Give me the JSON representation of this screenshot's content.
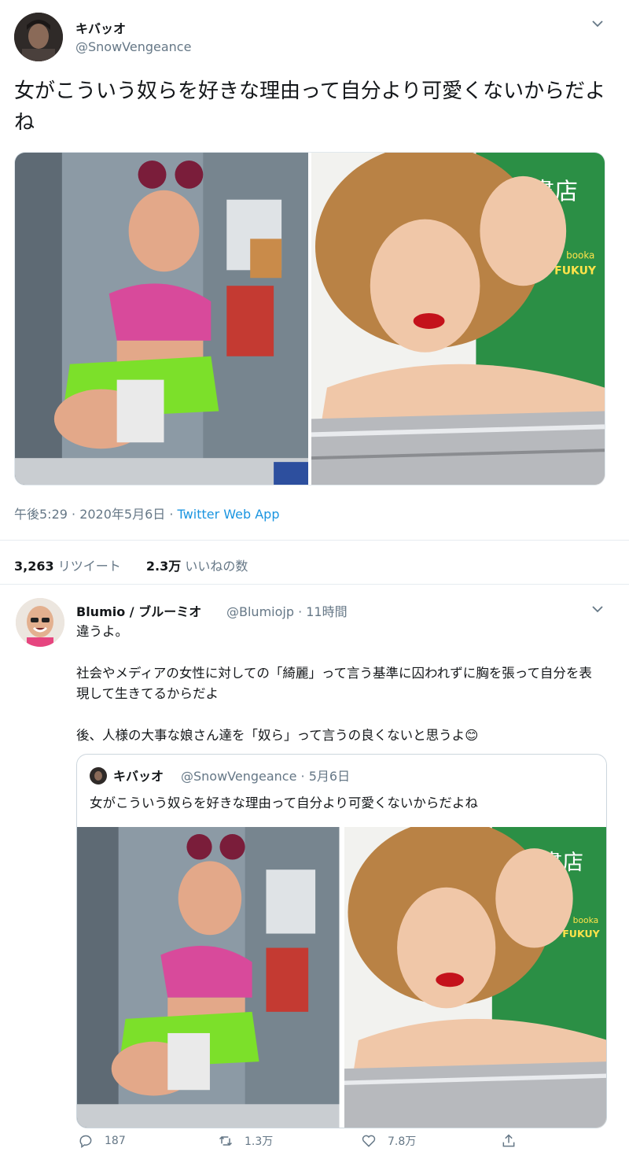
{
  "tweet": {
    "author_name": "キバッオ",
    "author_handle": "@SnowVengeance",
    "text": "女がこういう奴らを好きな理由って自分より可愛くないからだよね",
    "timestamp": "午後5:29 · 2020年5月6日 · ",
    "source": "Twitter Web App",
    "retweet_count": "3,263",
    "retweet_label": " リツイート",
    "like_count": "2.3万",
    "like_label": " いいねの数"
  },
  "reply": {
    "author_name": "Blumio / ブルーミオ",
    "author_handle": "@Blumiojp · 11時間",
    "line1": "違うよ。",
    "line2": "社会やメディアの女性に対しての「綺麗」って言う基準に囚われずに胸を張って自分を表現して生きてるからだよ",
    "line3": "後、人様の大事な娘さん達を「奴ら」って言うの良くないと思うよ😊",
    "quote": {
      "author_name": "キバッオ",
      "author_handle": "@SnowVengeance · 5月6日",
      "text": "女がこういう奴らを好きな理由って自分より可愛くないからだよね"
    },
    "actions": {
      "reply_count": "187",
      "retweet_count": "1.3万",
      "like_count": "7.8万"
    }
  },
  "photo_signage": {
    "store_sign": "家書店",
    "store_sub1": "booka",
    "store_sub2": "FUKUY"
  },
  "colors": {
    "link": "#1b95e0",
    "secondary_text": "#657786",
    "divider": "#e6ecf0"
  }
}
